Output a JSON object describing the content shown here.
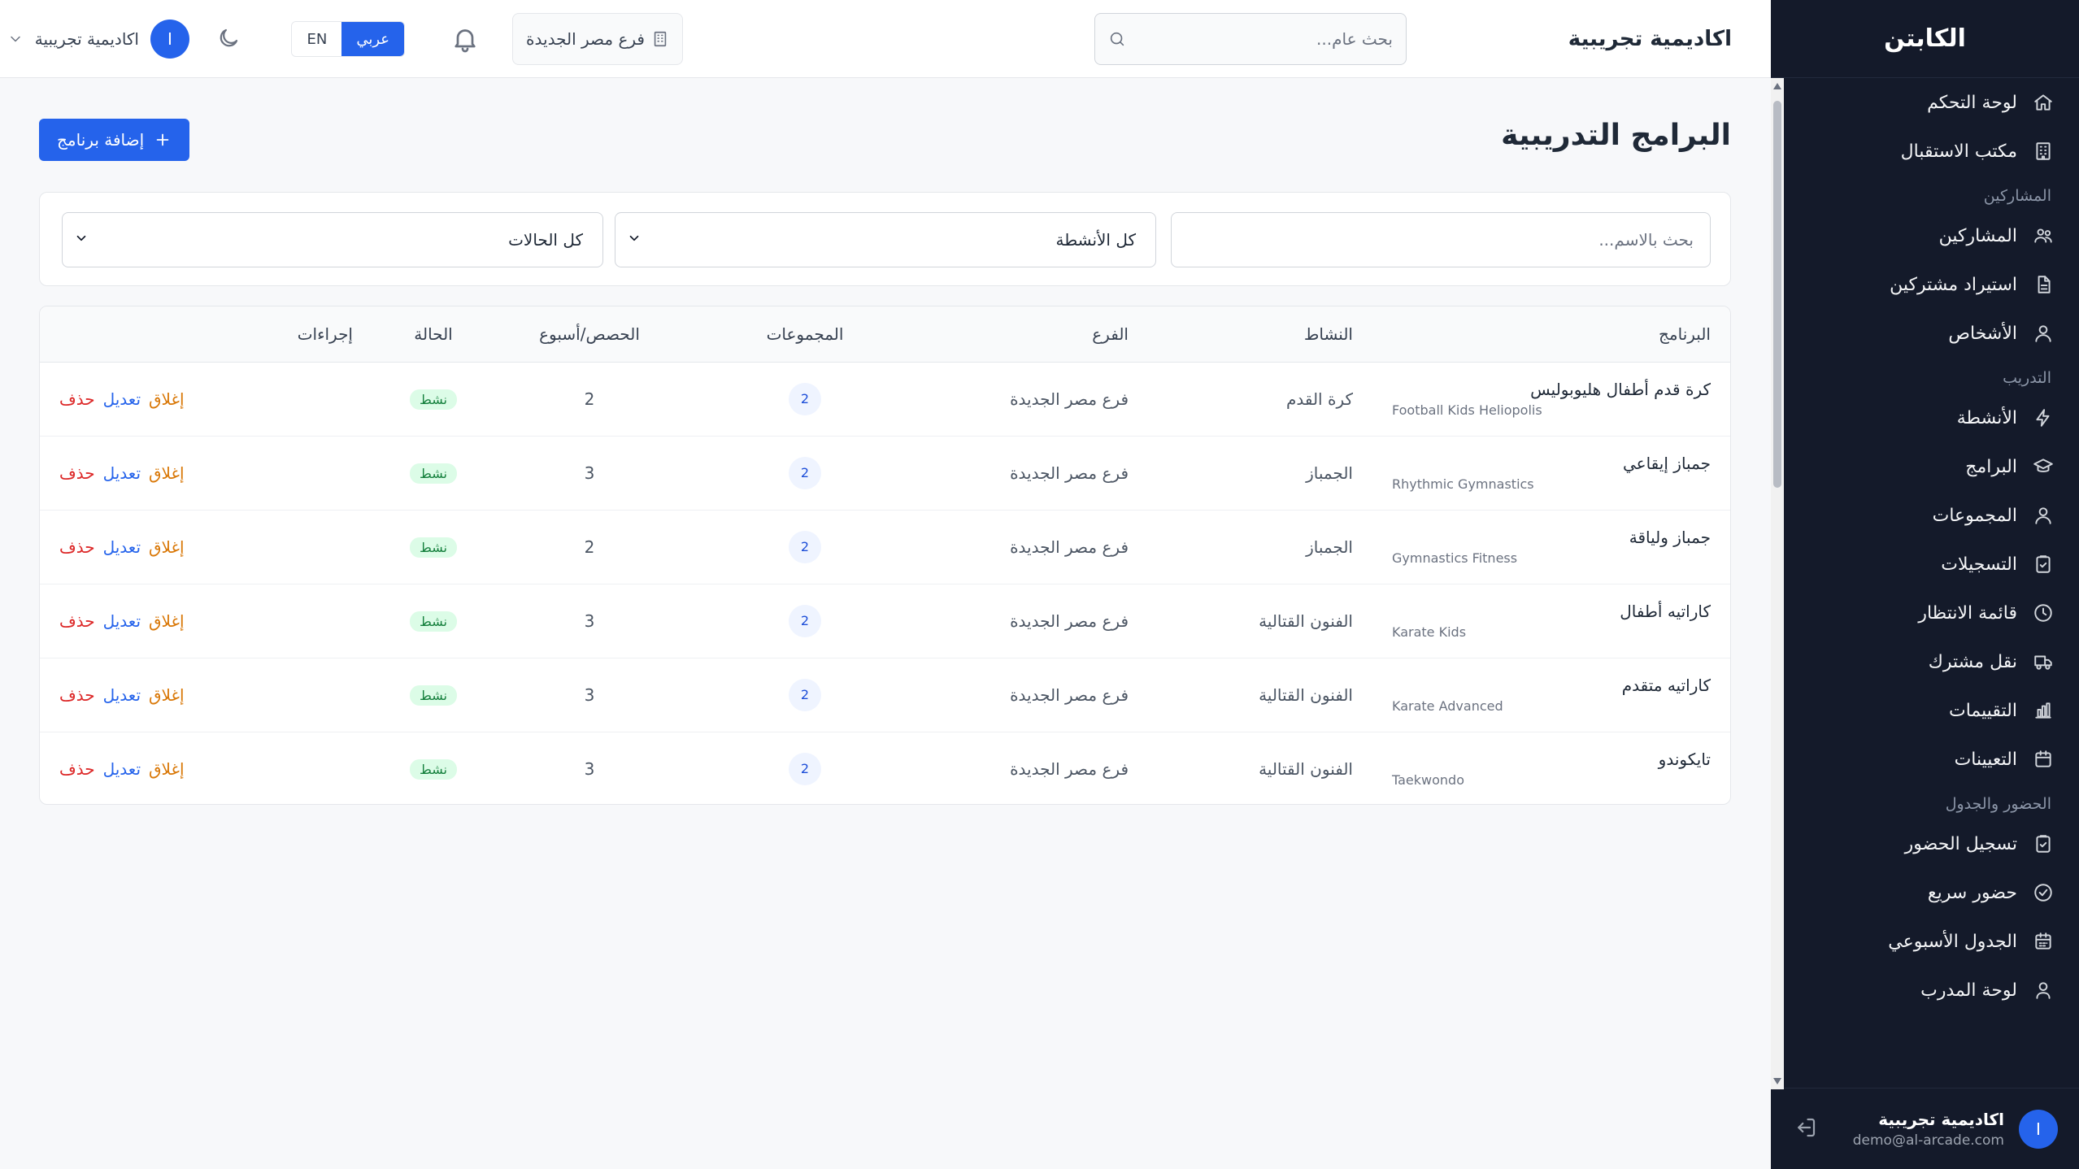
{
  "sidebar": {
    "brand": "الكابتن",
    "items": [
      {
        "type": "item",
        "label": "لوحة التحكم",
        "icon": "home-icon"
      },
      {
        "type": "item",
        "label": "مكتب الاستقبال",
        "icon": "building-icon"
      },
      {
        "type": "section",
        "label": "المشاركين"
      },
      {
        "type": "item",
        "label": "المشاركين",
        "icon": "users-icon"
      },
      {
        "type": "item",
        "label": "استيراد مشتركين",
        "icon": "file-icon"
      },
      {
        "type": "item",
        "label": "الأشخاص",
        "icon": "people-icon"
      },
      {
        "type": "section",
        "label": "التدريب"
      },
      {
        "type": "item",
        "label": "الأنشطة",
        "icon": "bolt-icon"
      },
      {
        "type": "item",
        "label": "البرامج",
        "icon": "graduation-cap-icon"
      },
      {
        "type": "item",
        "label": "المجموعات",
        "icon": "group-icon"
      },
      {
        "type": "item",
        "label": "التسجيلات",
        "icon": "clipboard-icon"
      },
      {
        "type": "item",
        "label": "قائمة الانتظار",
        "icon": "clock-icon"
      },
      {
        "type": "item",
        "label": "نقل مشترك",
        "icon": "truck-icon"
      },
      {
        "type": "item",
        "label": "التقييمات",
        "icon": "bar-chart-icon"
      },
      {
        "type": "item",
        "label": "التعيينات",
        "icon": "calendar-icon"
      },
      {
        "type": "section",
        "label": "الحضور والجدول"
      },
      {
        "type": "item",
        "label": "تسجيل الحضور",
        "icon": "clipboard-check-icon"
      },
      {
        "type": "item",
        "label": "حضور سريع",
        "icon": "check-circle-icon"
      },
      {
        "type": "item",
        "label": "الجدول الأسبوعي",
        "icon": "calendar-week-icon"
      },
      {
        "type": "item",
        "label": "لوحة المدرب",
        "icon": "user-icon"
      }
    ],
    "footer": {
      "avatar_initial": "I",
      "user_name": "اكاديمية تجريبية",
      "email": "demo@al-arcade.com"
    }
  },
  "topbar": {
    "title": "اكاديمية تجريبية",
    "search_placeholder": "بحث عام...",
    "branch": "فرع مصر الجديدة",
    "lang_ar": "عربي",
    "lang_en": "EN",
    "user_name": "اكاديمية تجريبية",
    "avatar_initial": "I"
  },
  "main": {
    "title": "البرامج التدريبية",
    "add_button": "إضافة برنامج",
    "filters": {
      "search_placeholder": "بحث بالاسم...",
      "activity_value": "كل الأنشطة",
      "status_value": "كل الحالات"
    },
    "table": {
      "headers": [
        "البرنامج",
        "النشاط",
        "الفرع",
        "المجموعات",
        "الحصص/أسبوع",
        "الحالة",
        "إجراءات"
      ],
      "rows": [
        {
          "name": "كرة قدم أطفال هليوبوليس",
          "name_en": "Football Kids Heliopolis",
          "activity": "كرة القدم",
          "branch": "فرع مصر الجديدة",
          "groups": "2",
          "sessions": "2",
          "status": "نشط"
        },
        {
          "name": "جمباز إيقاعي",
          "name_en": "Rhythmic Gymnastics",
          "activity": "الجمباز",
          "branch": "فرع مصر الجديدة",
          "groups": "2",
          "sessions": "3",
          "status": "نشط"
        },
        {
          "name": "جمباز ولياقة",
          "name_en": "Gymnastics Fitness",
          "activity": "الجمباز",
          "branch": "فرع مصر الجديدة",
          "groups": "2",
          "sessions": "2",
          "status": "نشط"
        },
        {
          "name": "كاراتيه أطفال",
          "name_en": "Karate Kids",
          "activity": "الفنون القتالية",
          "branch": "فرع مصر الجديدة",
          "groups": "2",
          "sessions": "3",
          "status": "نشط"
        },
        {
          "name": "كاراتيه متقدم",
          "name_en": "Karate Advanced",
          "activity": "الفنون القتالية",
          "branch": "فرع مصر الجديدة",
          "groups": "2",
          "sessions": "3",
          "status": "نشط"
        },
        {
          "name": "تايكوندو",
          "name_en": "Taekwondo",
          "activity": "الفنون القتالية",
          "branch": "فرع مصر الجديدة",
          "groups": "2",
          "sessions": "3",
          "status": "نشط"
        }
      ],
      "actions": {
        "close": "إغلاق",
        "edit": "تعديل",
        "delete": "حذف"
      }
    }
  },
  "colors": {
    "sidebar_bg": "#141a2a",
    "primary": "#2563eb",
    "status_active_bg": "#dcfce7",
    "status_active_text": "#15803d",
    "action_close": "#d97706",
    "action_edit": "#2563eb",
    "action_delete": "#dc2626"
  }
}
